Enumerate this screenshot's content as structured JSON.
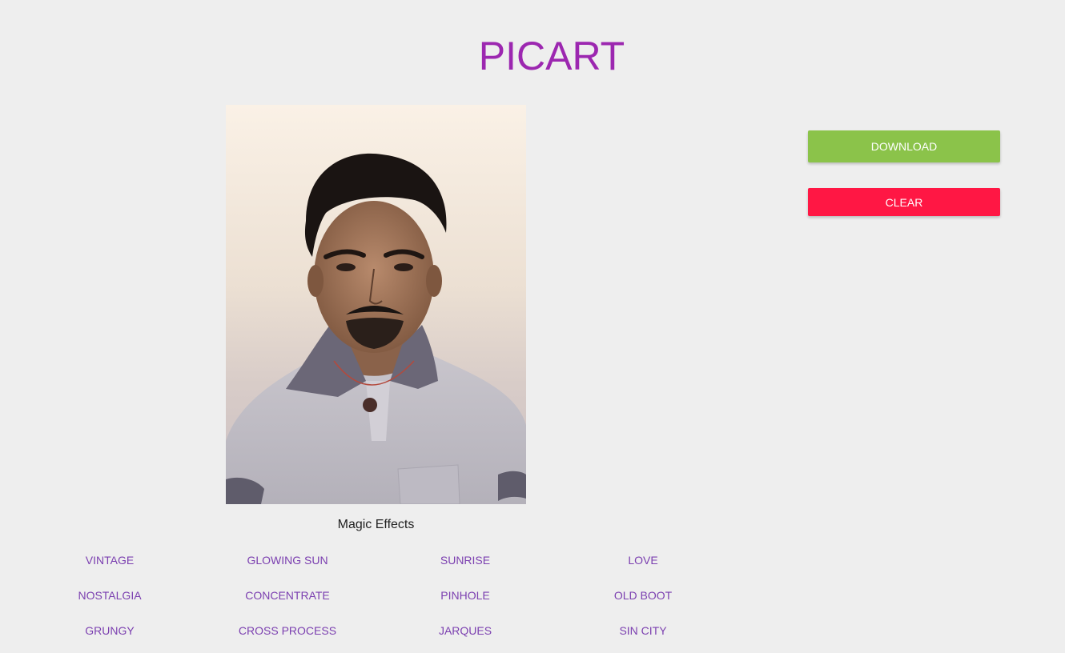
{
  "app": {
    "title": "PICART",
    "accent_color": "#9c27b0"
  },
  "photo": {
    "description_icon": "portrait-photo"
  },
  "actions": {
    "download_label": "DOWNLOAD",
    "download_color": "#8bc34a",
    "clear_label": "CLEAR",
    "clear_color": "#ff1744"
  },
  "effects": {
    "caption": "Magic Effects",
    "items": [
      "VINTAGE",
      "GLOWING SUN",
      "SUNRISE",
      "LOVE",
      "NOSTALGIA",
      "CONCENTRATE",
      "PINHOLE",
      "OLD BOOT",
      "GRUNGY",
      "CROSS PROCESS",
      "JARQUES",
      "SIN CITY"
    ]
  }
}
